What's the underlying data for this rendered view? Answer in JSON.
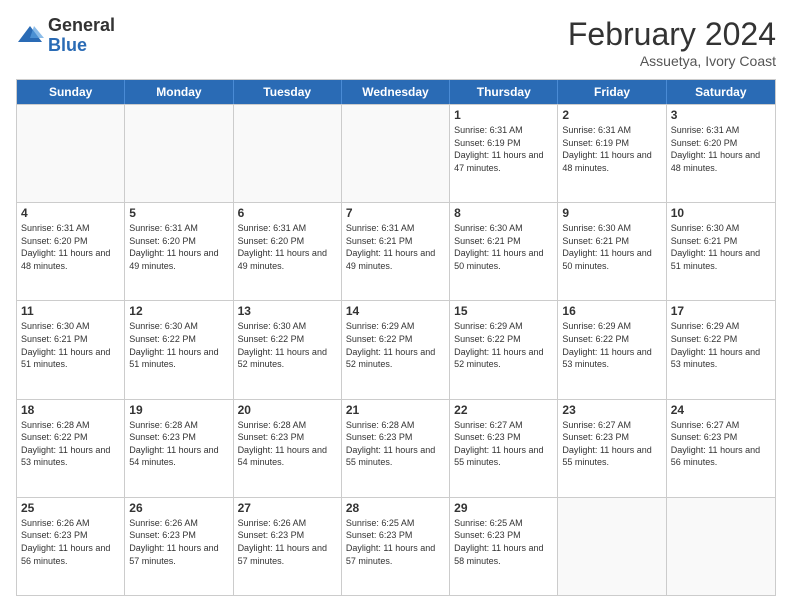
{
  "logo": {
    "general": "General",
    "blue": "Blue"
  },
  "header": {
    "title": "February 2024",
    "subtitle": "Assuetya, Ivory Coast"
  },
  "days": [
    "Sunday",
    "Monday",
    "Tuesday",
    "Wednesday",
    "Thursday",
    "Friday",
    "Saturday"
  ],
  "rows": [
    [
      {
        "day": "",
        "empty": true
      },
      {
        "day": "",
        "empty": true
      },
      {
        "day": "",
        "empty": true
      },
      {
        "day": "",
        "empty": true
      },
      {
        "day": "1",
        "sunrise": "Sunrise: 6:31 AM",
        "sunset": "Sunset: 6:19 PM",
        "daylight": "Daylight: 11 hours and 47 minutes."
      },
      {
        "day": "2",
        "sunrise": "Sunrise: 6:31 AM",
        "sunset": "Sunset: 6:19 PM",
        "daylight": "Daylight: 11 hours and 48 minutes."
      },
      {
        "day": "3",
        "sunrise": "Sunrise: 6:31 AM",
        "sunset": "Sunset: 6:20 PM",
        "daylight": "Daylight: 11 hours and 48 minutes."
      }
    ],
    [
      {
        "day": "4",
        "sunrise": "Sunrise: 6:31 AM",
        "sunset": "Sunset: 6:20 PM",
        "daylight": "Daylight: 11 hours and 48 minutes."
      },
      {
        "day": "5",
        "sunrise": "Sunrise: 6:31 AM",
        "sunset": "Sunset: 6:20 PM",
        "daylight": "Daylight: 11 hours and 49 minutes."
      },
      {
        "day": "6",
        "sunrise": "Sunrise: 6:31 AM",
        "sunset": "Sunset: 6:20 PM",
        "daylight": "Daylight: 11 hours and 49 minutes."
      },
      {
        "day": "7",
        "sunrise": "Sunrise: 6:31 AM",
        "sunset": "Sunset: 6:21 PM",
        "daylight": "Daylight: 11 hours and 49 minutes."
      },
      {
        "day": "8",
        "sunrise": "Sunrise: 6:30 AM",
        "sunset": "Sunset: 6:21 PM",
        "daylight": "Daylight: 11 hours and 50 minutes."
      },
      {
        "day": "9",
        "sunrise": "Sunrise: 6:30 AM",
        "sunset": "Sunset: 6:21 PM",
        "daylight": "Daylight: 11 hours and 50 minutes."
      },
      {
        "day": "10",
        "sunrise": "Sunrise: 6:30 AM",
        "sunset": "Sunset: 6:21 PM",
        "daylight": "Daylight: 11 hours and 51 minutes."
      }
    ],
    [
      {
        "day": "11",
        "sunrise": "Sunrise: 6:30 AM",
        "sunset": "Sunset: 6:21 PM",
        "daylight": "Daylight: 11 hours and 51 minutes."
      },
      {
        "day": "12",
        "sunrise": "Sunrise: 6:30 AM",
        "sunset": "Sunset: 6:22 PM",
        "daylight": "Daylight: 11 hours and 51 minutes."
      },
      {
        "day": "13",
        "sunrise": "Sunrise: 6:30 AM",
        "sunset": "Sunset: 6:22 PM",
        "daylight": "Daylight: 11 hours and 52 minutes."
      },
      {
        "day": "14",
        "sunrise": "Sunrise: 6:29 AM",
        "sunset": "Sunset: 6:22 PM",
        "daylight": "Daylight: 11 hours and 52 minutes."
      },
      {
        "day": "15",
        "sunrise": "Sunrise: 6:29 AM",
        "sunset": "Sunset: 6:22 PM",
        "daylight": "Daylight: 11 hours and 52 minutes."
      },
      {
        "day": "16",
        "sunrise": "Sunrise: 6:29 AM",
        "sunset": "Sunset: 6:22 PM",
        "daylight": "Daylight: 11 hours and 53 minutes."
      },
      {
        "day": "17",
        "sunrise": "Sunrise: 6:29 AM",
        "sunset": "Sunset: 6:22 PM",
        "daylight": "Daylight: 11 hours and 53 minutes."
      }
    ],
    [
      {
        "day": "18",
        "sunrise": "Sunrise: 6:28 AM",
        "sunset": "Sunset: 6:22 PM",
        "daylight": "Daylight: 11 hours and 53 minutes."
      },
      {
        "day": "19",
        "sunrise": "Sunrise: 6:28 AM",
        "sunset": "Sunset: 6:23 PM",
        "daylight": "Daylight: 11 hours and 54 minutes."
      },
      {
        "day": "20",
        "sunrise": "Sunrise: 6:28 AM",
        "sunset": "Sunset: 6:23 PM",
        "daylight": "Daylight: 11 hours and 54 minutes."
      },
      {
        "day": "21",
        "sunrise": "Sunrise: 6:28 AM",
        "sunset": "Sunset: 6:23 PM",
        "daylight": "Daylight: 11 hours and 55 minutes."
      },
      {
        "day": "22",
        "sunrise": "Sunrise: 6:27 AM",
        "sunset": "Sunset: 6:23 PM",
        "daylight": "Daylight: 11 hours and 55 minutes."
      },
      {
        "day": "23",
        "sunrise": "Sunrise: 6:27 AM",
        "sunset": "Sunset: 6:23 PM",
        "daylight": "Daylight: 11 hours and 55 minutes."
      },
      {
        "day": "24",
        "sunrise": "Sunrise: 6:27 AM",
        "sunset": "Sunset: 6:23 PM",
        "daylight": "Daylight: 11 hours and 56 minutes."
      }
    ],
    [
      {
        "day": "25",
        "sunrise": "Sunrise: 6:26 AM",
        "sunset": "Sunset: 6:23 PM",
        "daylight": "Daylight: 11 hours and 56 minutes."
      },
      {
        "day": "26",
        "sunrise": "Sunrise: 6:26 AM",
        "sunset": "Sunset: 6:23 PM",
        "daylight": "Daylight: 11 hours and 57 minutes."
      },
      {
        "day": "27",
        "sunrise": "Sunrise: 6:26 AM",
        "sunset": "Sunset: 6:23 PM",
        "daylight": "Daylight: 11 hours and 57 minutes."
      },
      {
        "day": "28",
        "sunrise": "Sunrise: 6:25 AM",
        "sunset": "Sunset: 6:23 PM",
        "daylight": "Daylight: 11 hours and 57 minutes."
      },
      {
        "day": "29",
        "sunrise": "Sunrise: 6:25 AM",
        "sunset": "Sunset: 6:23 PM",
        "daylight": "Daylight: 11 hours and 58 minutes."
      },
      {
        "day": "",
        "empty": true
      },
      {
        "day": "",
        "empty": true
      }
    ]
  ]
}
